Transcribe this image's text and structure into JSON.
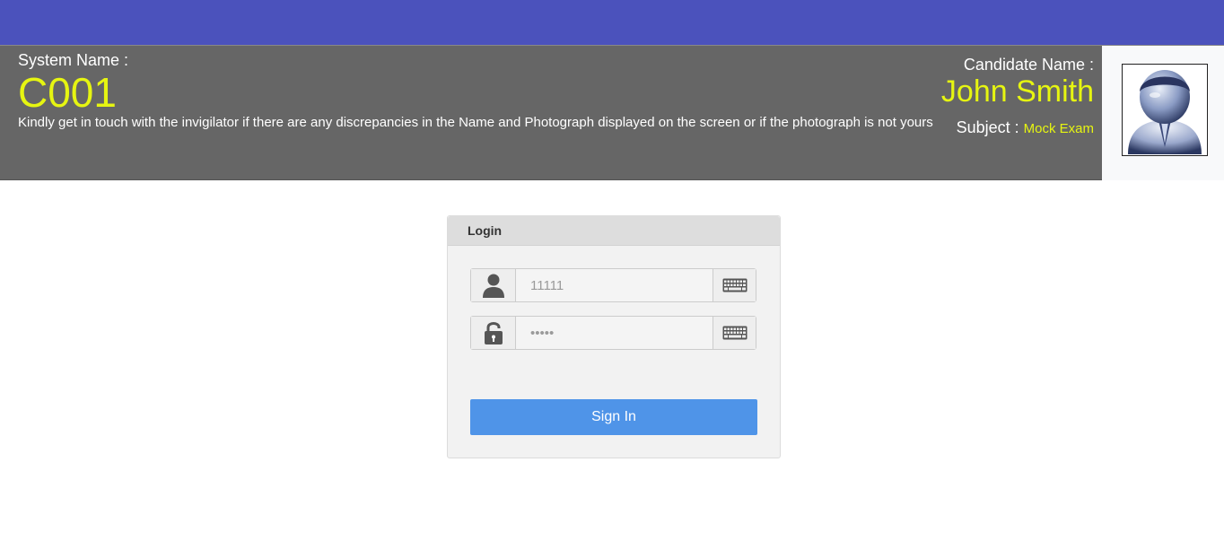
{
  "header": {
    "system_label": "System Name :",
    "system_name": "C001",
    "notice": "Kindly get in touch with the invigilator if there are any discrepancies in the Name and Photograph displayed on the screen or if the photograph is not yours",
    "candidate_label": "Candidate Name :",
    "candidate_name": "John Smith",
    "subject_label": "Subject : ",
    "subject_value": "Mock Exam",
    "photo_icon": "candidate-avatar",
    "colors": {
      "topbar": "#4b52bc",
      "header_bg": "#666666",
      "highlight": "#e6f511"
    }
  },
  "login": {
    "title": "Login",
    "username_placeholder": "11111",
    "password_placeholder": "•••••",
    "user_icon": "user-icon",
    "lock_icon": "lock-icon",
    "keyboard_icon": "keyboard-icon",
    "signin_label": "Sign In",
    "signin_color": "#4f94e8"
  }
}
